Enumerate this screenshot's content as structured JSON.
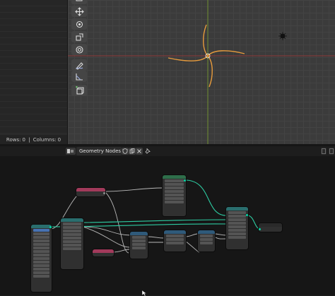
{
  "spreadsheet": {
    "rows_label": "Rows:",
    "rows_value": "0",
    "columns_label": "Columns:",
    "columns_value": "0"
  },
  "toolbar": {
    "tools": [
      "select-box-icon",
      "move-icon",
      "rotate-icon",
      "scale-icon",
      "transform-icon",
      "annotate-icon",
      "measure-icon",
      "add-cube-icon"
    ]
  },
  "node_editor": {
    "editor_type_icon": "node-editor-icon",
    "tree_name": "Geometry Nodes",
    "header_icons": [
      "fake-user-shield-icon",
      "copy-icon",
      "close-icon",
      "pin-icon"
    ]
  },
  "colors": {
    "geometry_socket": "#00d6a3",
    "link": "#b8b8b8",
    "geometry_link": "#2dcca2",
    "curve_orange": "#e79b3c",
    "red_axis": "#8e3a3a",
    "green_axis": "#6d8e2f",
    "node_header_teal": "#2a6e6e",
    "node_header_pink": "#a23a5b",
    "node_header_blue": "#2f5a7a",
    "node_header_green": "#2e6e4a"
  }
}
